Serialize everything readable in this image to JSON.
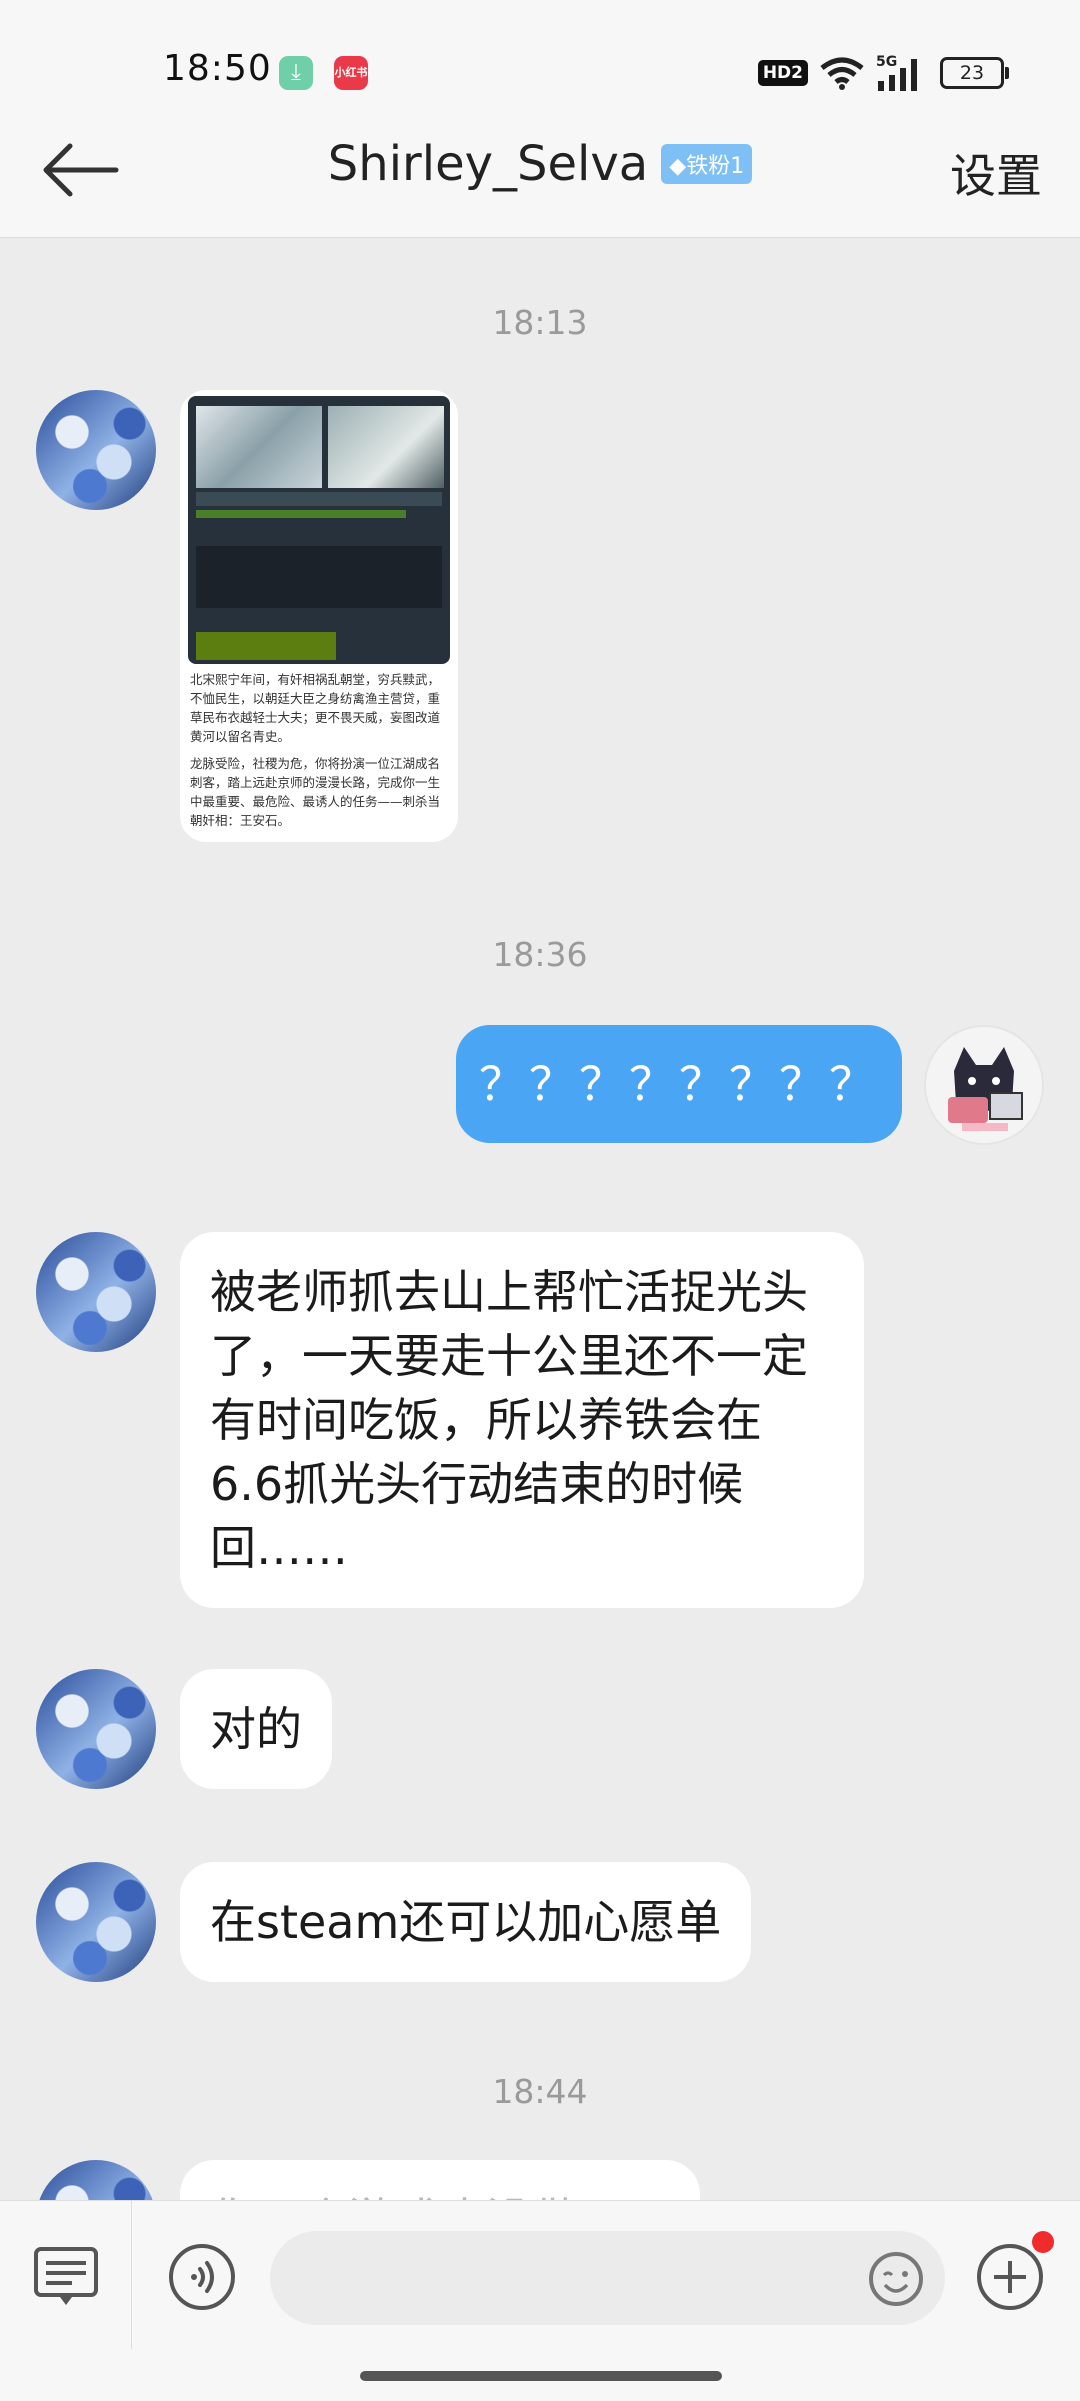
{
  "status_bar": {
    "time": "18:50",
    "network": "5G",
    "hd": "HD2",
    "battery": "23"
  },
  "header": {
    "title": "Shirley_Selva",
    "fan_badge": "◆铁粉1",
    "settings": "设置"
  },
  "messages": {
    "ts1": "18:13",
    "image_text_p1": "北宋熙宁年间，有奸相祸乱朝堂，穷兵黩武，不恤民生，以朝廷大臣之身纺禽渔主营贷，重草民布衣越轻士大夫；更不畏天威，妄图改道黄河以留名青史。",
    "image_text_p2": "龙脉受险，社稷为危，你将扮演一位江湖成名刺客，踏上远赴京师的漫漫长路，完成你一生中最重要、最危险、最诱人的任务——刺杀当朝奸相：王安石。",
    "ts2": "18:36",
    "my_msg": "？？？？？？？？",
    "msg1": "被老师抓去山上帮忙活捉光头了，一天要走十公里还不一定有时间吃饭，所以养铁会在6.6抓光头行动结束的时候回……",
    "msg2": "对的",
    "msg3": "在steam还可以加心愿单",
    "ts3": "18:44",
    "msg4": "你一个游戏也没做……"
  },
  "input": {
    "placeholder": ""
  }
}
